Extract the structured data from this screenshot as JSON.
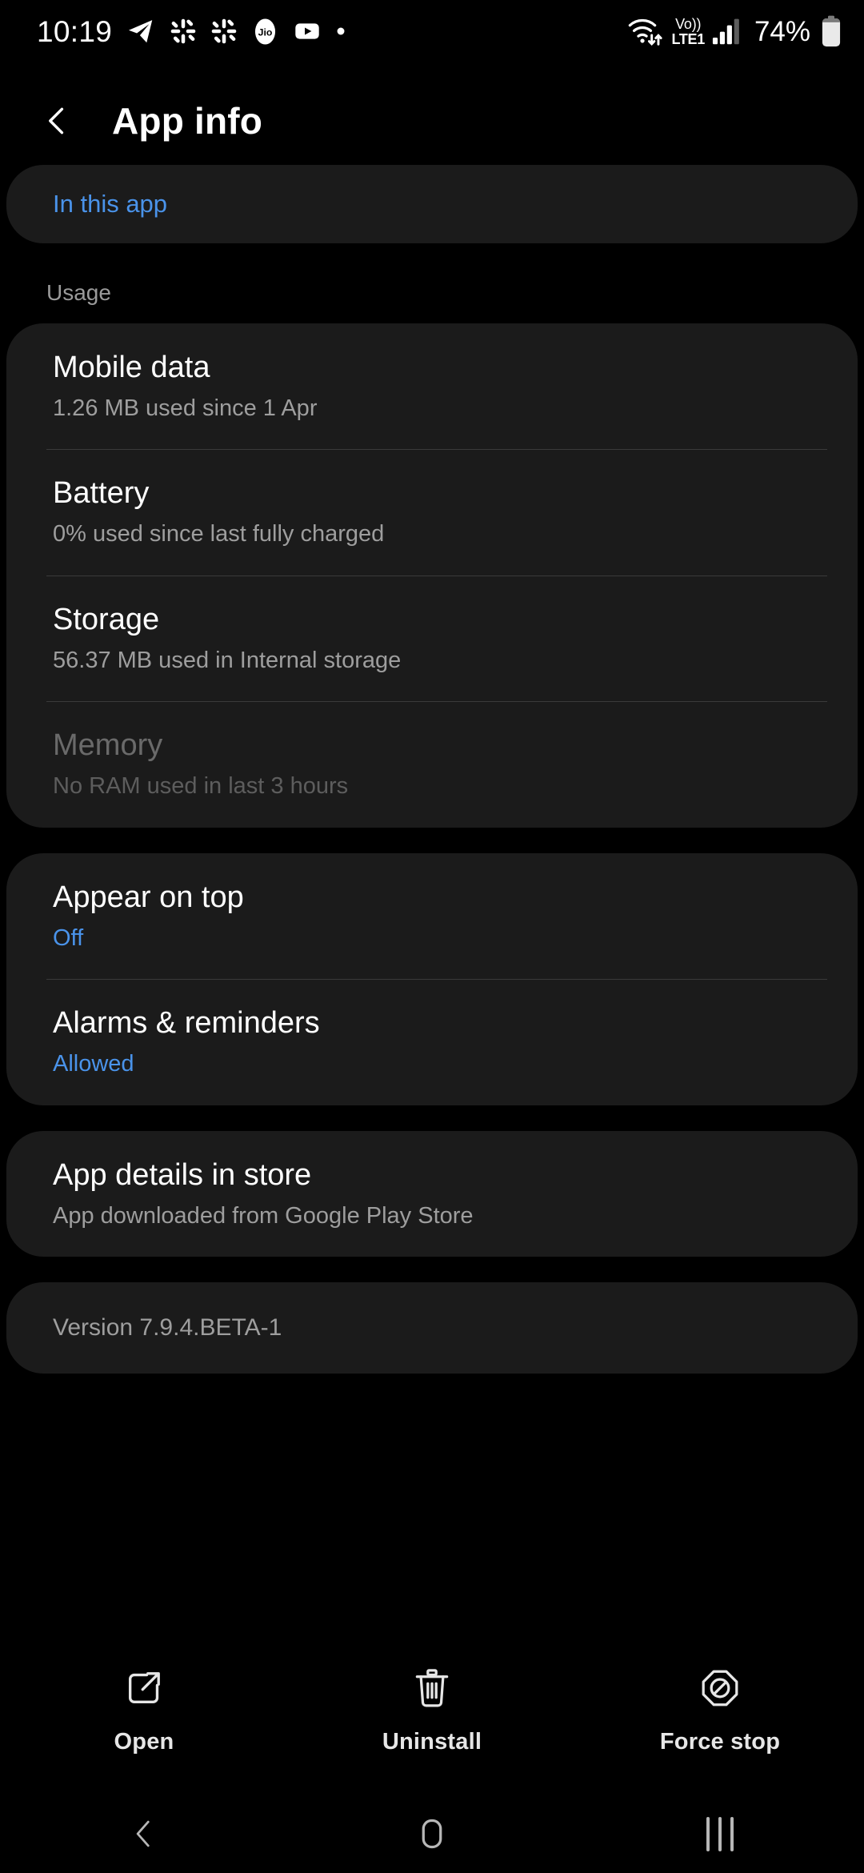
{
  "status_bar": {
    "time": "10:19",
    "left_icons": [
      {
        "name": "telegram-icon"
      },
      {
        "name": "slack-icon"
      },
      {
        "name": "slack-icon-2"
      },
      {
        "name": "jio-icon"
      },
      {
        "name": "youtube-icon"
      },
      {
        "name": "more-notifications-dot-icon"
      }
    ],
    "wifi_icon": "wifi-data-transfer-icon",
    "volte_top": "Vo))",
    "volte_bottom": "LTE1",
    "signal_icon": "cellular-signal-icon",
    "battery_percent": "74%",
    "battery_icon": "battery-icon"
  },
  "header": {
    "back_icon": "back-chevron-icon",
    "title": "App info"
  },
  "in_this_app": {
    "label": "In this app"
  },
  "usage": {
    "section_label": "Usage",
    "rows": [
      {
        "title": "Mobile data",
        "subtitle": "1.26 MB used since 1 Apr",
        "disabled": false,
        "accent": false
      },
      {
        "title": "Battery",
        "subtitle": "0% used since last fully charged",
        "disabled": false,
        "accent": false
      },
      {
        "title": "Storage",
        "subtitle": "56.37 MB used in Internal storage",
        "disabled": false,
        "accent": false
      },
      {
        "title": "Memory",
        "subtitle": "No RAM used in last 3 hours",
        "disabled": true,
        "accent": false
      }
    ]
  },
  "permissions": {
    "rows": [
      {
        "title": "Appear on top",
        "subtitle": "Off",
        "accent": true
      },
      {
        "title": "Alarms & reminders",
        "subtitle": "Allowed",
        "accent": true
      }
    ]
  },
  "store": {
    "title": "App details in store",
    "subtitle": "App downloaded from Google Play Store"
  },
  "version": {
    "text": "Version 7.9.4.BETA-1"
  },
  "actions": [
    {
      "label": "Open",
      "icon": "open-external-icon"
    },
    {
      "label": "Uninstall",
      "icon": "trash-icon"
    },
    {
      "label": "Force stop",
      "icon": "force-stop-icon"
    }
  ],
  "nav_bar": {
    "back": "nav-back-icon",
    "home": "nav-home-icon",
    "recents": "nav-recents-icon"
  },
  "colors": {
    "background": "#000000",
    "card": "#1b1b1b",
    "accent_blue": "#4a93ea",
    "primary_text": "#ffffff",
    "secondary_text": "#9e9e9e",
    "disabled_text": "#6a6a6a"
  }
}
